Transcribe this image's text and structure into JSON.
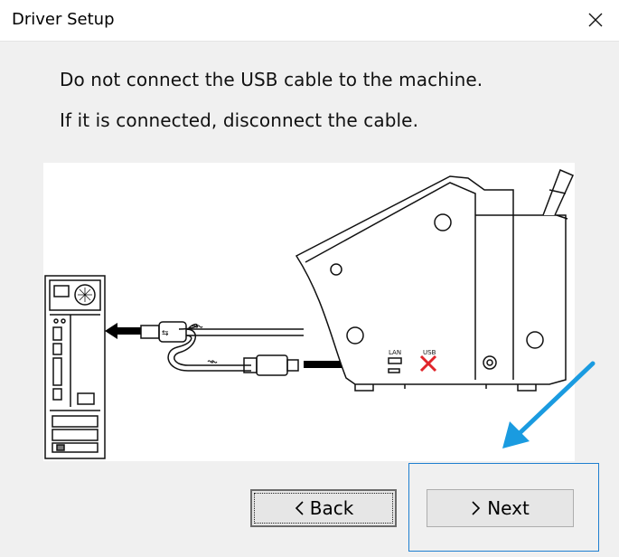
{
  "window": {
    "title": "Driver Setup"
  },
  "content": {
    "line1": "Do not connect the USB cable to the machine.",
    "line2": "If it is connected, disconnect the cable."
  },
  "illustration": {
    "port_label_lan": "LAN",
    "port_label_usb": "USB"
  },
  "buttons": {
    "back_label": "Back",
    "next_label": "Next"
  },
  "icons": {
    "close": "close-icon",
    "back": "chevron-left-icon",
    "next": "chevron-right-icon",
    "pointer": "blue-arrow-icon",
    "disconnect": "red-x-icon"
  },
  "colors": {
    "highlight": "#1e7fd0",
    "pointer_arrow": "#1a9be0",
    "red_x": "#e0242a"
  }
}
